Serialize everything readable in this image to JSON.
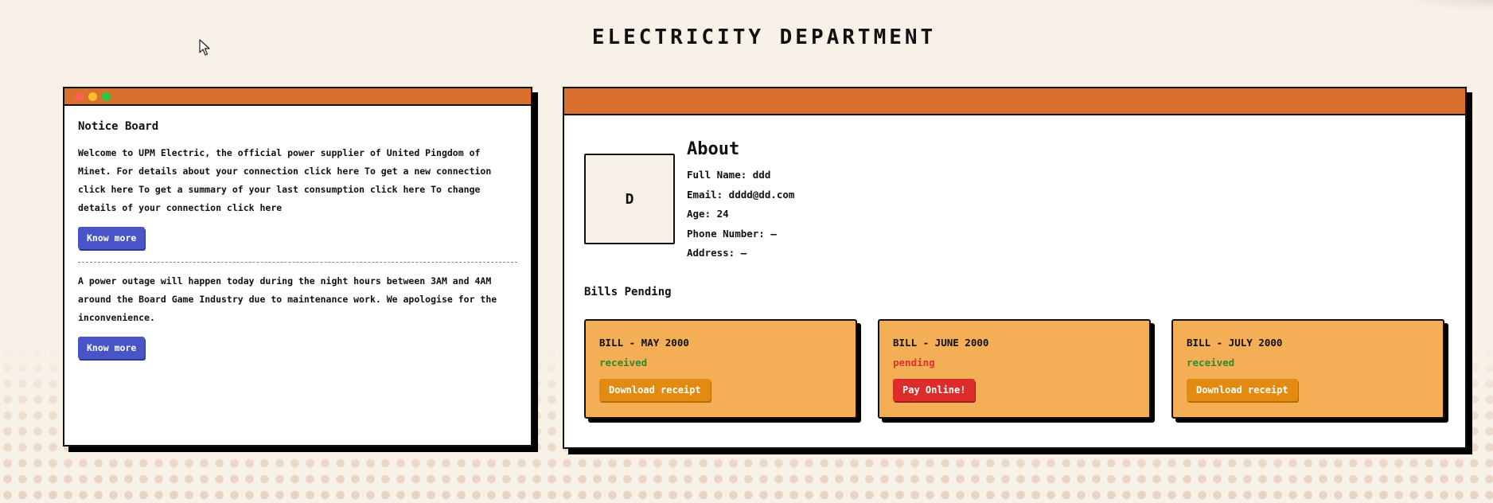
{
  "page": {
    "title": "ELECTRICITY DEPARTMENT"
  },
  "notice_board": {
    "title": "Notice Board",
    "notices": [
      {
        "text": "Welcome to UPM Electric, the official power supplier of United Pingdom of Minet. For details about your connection click here To get a new connection click here To get a summary of your last consumption click here To change details of your connection click here",
        "button_label": "Know more"
      },
      {
        "text": "A power outage will happen today during the night hours between 3AM and 4AM around the Board Game Industry due to maintenance work. We apologise for the inconvenience.",
        "button_label": "Know more"
      }
    ]
  },
  "profile": {
    "avatar_initial": "D",
    "about_title": "About",
    "fields": [
      "Full Name: ddd",
      "Email: dddd@dd.com",
      "Age: 24",
      "Phone Number: —",
      "Address: —"
    ]
  },
  "bills": {
    "title": "Bills Pending",
    "items": [
      {
        "name": "BILL - MAY 2000",
        "status": "received",
        "button_label": "Download receipt"
      },
      {
        "name": "BILL - JUNE 2000",
        "status": "pending",
        "button_label": "Pay Online!"
      },
      {
        "name": "BILL - JULY 2000",
        "status": "received",
        "button_label": "Download receipt"
      }
    ]
  },
  "colors": {
    "background": "#f8f1e7",
    "titlebar": "#d9702e",
    "know_more_button": "#4a54c9",
    "bill_card": "#f4ae56",
    "download_button": "#e38a10",
    "pay_button": "#dc2c2c",
    "status_received": "#2e8b2e",
    "status_pending": "#e03030"
  },
  "icons": {
    "cursor": "mouse-pointer-icon",
    "window_controls": [
      "close-dot-icon",
      "minimize-dot-icon",
      "maximize-dot-icon"
    ]
  }
}
